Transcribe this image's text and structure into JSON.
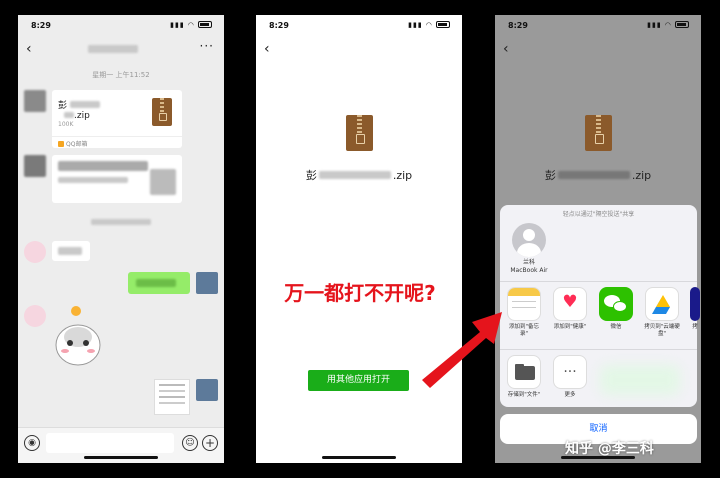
{
  "status": {
    "time": "8:29",
    "signal": "▮▮▮ ◠"
  },
  "screen1": {
    "timestamp": "星期一 上午11:52",
    "file_name": "彭",
    "file_ext": ".zip",
    "file_size": "100K",
    "file_source": "QQ邮箱"
  },
  "screen2": {
    "file_name_prefix": "彭",
    "file_ext": ".zip",
    "question": "万一都打不开呢?",
    "open_button": "用其他应用打开"
  },
  "screen3": {
    "file_name_prefix": "彭",
    "file_ext": ".zip",
    "sheet_title": "轻点以通过\"隔空投送\"共享",
    "airdrop_name": "兰科",
    "airdrop_device": "MacBook Air",
    "apps": [
      {
        "label": "添加到\"备忘录\"",
        "icon": "notes-icon"
      },
      {
        "label": "添加到\"健康\"",
        "icon": "health-icon"
      },
      {
        "label": "微信",
        "icon": "wechat-icon"
      },
      {
        "label": "拷贝到\"云端硬盘\"",
        "icon": "drive-icon"
      },
      {
        "label": "拷",
        "icon": "app-icon"
      }
    ],
    "actions": [
      {
        "label": "存储到\"文件\"",
        "icon": "folder-icon"
      },
      {
        "label": "更多",
        "icon": "more-icon"
      }
    ],
    "cancel": "取消"
  },
  "watermark": "知乎 @李三科"
}
